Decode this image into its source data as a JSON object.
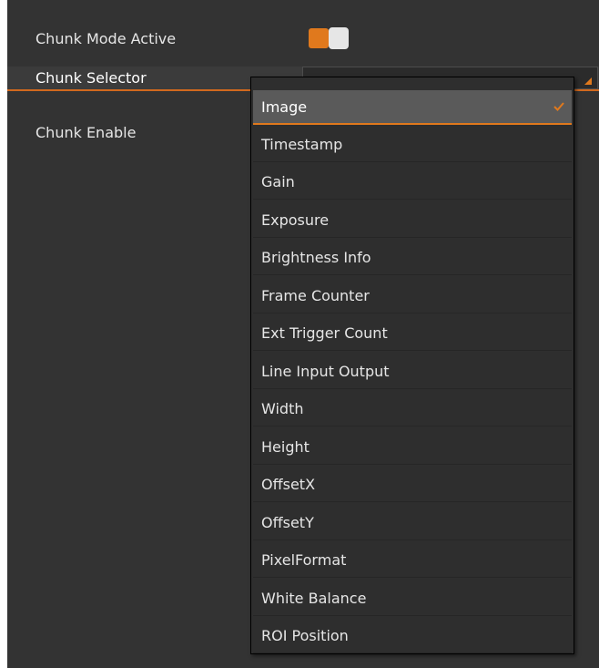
{
  "properties": {
    "mode_active_label": "Chunk Mode Active",
    "selector_label": "Chunk Selector",
    "enable_label": "Chunk Enable"
  },
  "toggle": {
    "state": "on",
    "accent": "#e0791d"
  },
  "dropdown": {
    "selected": "Image",
    "items": [
      "Image",
      "Timestamp",
      "Gain",
      "Exposure",
      "Brightness Info",
      "Frame Counter",
      "Ext Trigger Count",
      "Line Input Output",
      "Width",
      "Height",
      "OffsetX",
      "OffsetY",
      "PixelFormat",
      "White Balance",
      "ROI Position"
    ]
  },
  "colors": {
    "panel_bg": "#333333",
    "accent": "#e0791d",
    "text": "#e6e6e6"
  }
}
